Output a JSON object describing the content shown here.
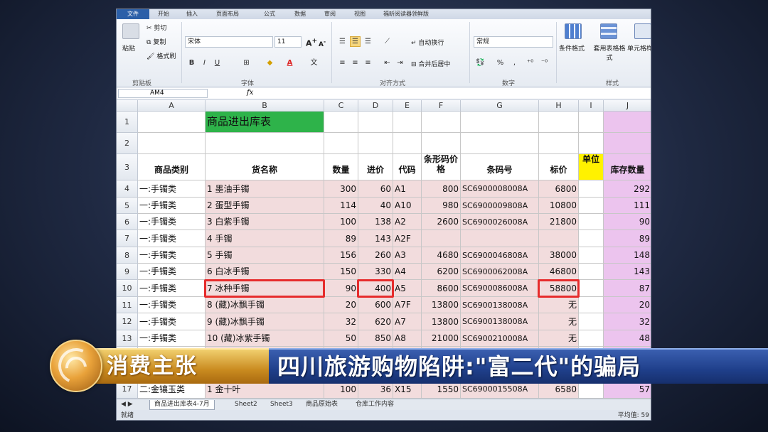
{
  "ribbon": {
    "tabs": [
      "文件",
      "开始",
      "插入",
      "页面布局",
      "公式",
      "数据",
      "审阅",
      "视图",
      "福昕阅读器领鲜版"
    ],
    "clipboard": {
      "cut": "剪切",
      "copy": "复制",
      "paste": "粘贴",
      "format_painter": "格式刷",
      "group": "剪贴板"
    },
    "font": {
      "name": "宋体",
      "size": "11",
      "group": "字体"
    },
    "alignment": {
      "wrap": "自动换行",
      "merge": "合并后居中",
      "group": "对齐方式"
    },
    "number": {
      "format": "常规",
      "percent": "%",
      "comma": ",",
      "group": "数字"
    },
    "styles": {
      "conditional": "条件格式",
      "table_format": "套用表格格式",
      "cell_styles": "单元格样",
      "group": "样式"
    }
  },
  "formula_bar": {
    "name_box": "AM4",
    "fx": "fx",
    "value": ""
  },
  "columns": [
    "A",
    "B",
    "C",
    "D",
    "E",
    "F",
    "G",
    "H",
    "I",
    "J"
  ],
  "sheet": {
    "title": "商品进出库表",
    "headers": [
      "商品类别",
      "货名称",
      "数量",
      "进价",
      "代码",
      "条形码价格",
      "条码号",
      "标价",
      "单位",
      "库存数量"
    ],
    "rows": [
      {
        "r": "4",
        "a": "一:手镯类",
        "b": "1 墨油手镯",
        "c": "300",
        "d": "60",
        "e": "A1",
        "f": "800",
        "g": "SC6900008008A",
        "h": "6800",
        "i": "",
        "j": "292"
      },
      {
        "r": "5",
        "a": "一:手镯类",
        "b": "2 蛋型手镯",
        "c": "114",
        "d": "40",
        "e": "A10",
        "f": "980",
        "g": "SC6900009808A",
        "h": "10800",
        "i": "",
        "j": "111"
      },
      {
        "r": "6",
        "a": "一:手镯类",
        "b": "3 白紫手镯",
        "c": "100",
        "d": "138",
        "e": "A2",
        "f": "2600",
        "g": "SC6900026008A",
        "h": "21800",
        "i": "",
        "j": "90"
      },
      {
        "r": "7",
        "a": "一:手镯类",
        "b": "4 手镯",
        "c": "89",
        "d": "143",
        "e": "A2F",
        "f": "",
        "g": "",
        "h": "",
        "i": "",
        "j": "89"
      },
      {
        "r": "8",
        "a": "一:手镯类",
        "b": "5 手镯",
        "c": "156",
        "d": "260",
        "e": "A3",
        "f": "4680",
        "g": "SC6900046808A",
        "h": "38000",
        "i": "",
        "j": "148"
      },
      {
        "r": "9",
        "a": "一:手镯类",
        "b": "6 白冰手镯",
        "c": "150",
        "d": "330",
        "e": "A4",
        "f": "6200",
        "g": "SC6900062008A",
        "h": "46800",
        "i": "",
        "j": "143"
      },
      {
        "r": "10",
        "a": "一:手镯类",
        "b": "7 冰种手镯",
        "c": "90",
        "d": "400",
        "e": "A5",
        "f": "8600",
        "g": "SC6900086008A",
        "h": "58800",
        "i": "",
        "j": "87"
      },
      {
        "r": "11",
        "a": "一:手镯类",
        "b": "8 (藏)冰飘手镯",
        "c": "20",
        "d": "600",
        "e": "A7F",
        "f": "13800",
        "g": "SC6900138008A",
        "h": "无",
        "i": "",
        "j": "20"
      },
      {
        "r": "12",
        "a": "一:手镯类",
        "b": "9 (藏)冰飘手镯",
        "c": "32",
        "d": "620",
        "e": "A7",
        "f": "13800",
        "g": "SC6900138008A",
        "h": "无",
        "i": "",
        "j": "32"
      },
      {
        "r": "13",
        "a": "一:手镯类",
        "b": "10 (藏)冰紫手镯",
        "c": "50",
        "d": "850",
        "e": "A8",
        "f": "21000",
        "g": "SC6900210008A",
        "h": "无",
        "i": "",
        "j": "48"
      },
      {
        "r": "17",
        "a": "二:金镶玉类",
        "b": "1 金十叶",
        "c": "100",
        "d": "36",
        "e": "X15",
        "f": "1550",
        "g": "SC6900015508A",
        "h": "6580",
        "i": "",
        "j": "57"
      }
    ]
  },
  "sheet_tabs": [
    "商品进出库表4-7月",
    "Sheet2",
    "Sheet3",
    "商品原始表",
    "仓库工作内容"
  ],
  "status": {
    "ready": "就绪",
    "average": "平均值: 59"
  },
  "banner": {
    "program": "消费主张",
    "headline": "四川旅游购物陷阱:\"富二代\"的骗局"
  },
  "colors": {
    "pink": "#f2dcdd",
    "purple": "#ecc4ee",
    "yellow": "#fff200",
    "green": "#2eb34a",
    "highlight": "#e62c2c",
    "banner_blue": "#1f3f8a",
    "banner_gold": "#c98a1f"
  }
}
